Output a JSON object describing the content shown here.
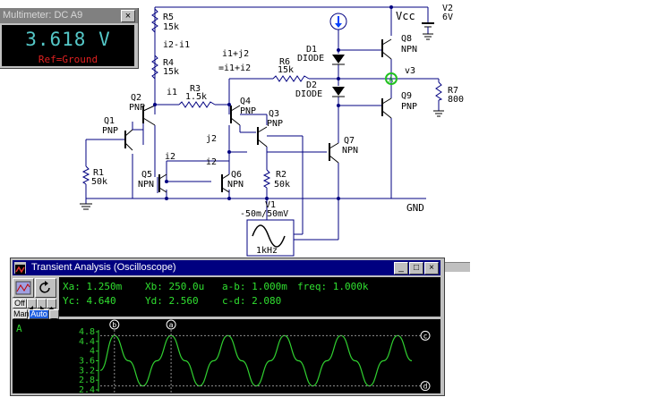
{
  "schematic": {
    "labels": {
      "r5": "R5",
      "r5_val": "15k",
      "i2_i1": "i2-i1",
      "r4": "R4",
      "r4_val": "15k",
      "i1": "i1",
      "r3": "R3",
      "r3_val": "1.5k",
      "i1_j2": "i1+j2",
      "eq": "=i1+i2",
      "r6": "R6",
      "r6_val": "15k",
      "d1": "D1",
      "d1_type": "DIODE",
      "d2": "D2",
      "d2_type": "DIODE",
      "vcc": "Vcc",
      "v2": "V2",
      "v2_val": "6V",
      "q8": "Q8",
      "q8_type": "NPN",
      "v3": "v3",
      "q9": "Q9",
      "q9_type": "PNP",
      "r7": "R7",
      "r7_val": "800",
      "q2": "Q2",
      "q2_type": "PNP",
      "q1": "Q1",
      "q1_type": "PNP",
      "q4": "Q4",
      "q4_type": "PNP",
      "q3": "Q3",
      "q3_type": "PNP",
      "j2": "j2",
      "q7": "Q7",
      "q7_type": "NPN",
      "r1": "R1",
      "r1_val": "50k",
      "i2a": "i2",
      "i2b": "i2",
      "q5": "Q5",
      "q5_type": "NPN",
      "q6": "Q6",
      "q6_type": "NPN",
      "r2": "R2",
      "r2_val": "50k",
      "gnd": "GND",
      "v1": "V1",
      "v1_val": "-50m/50mV",
      "v1_freq": "1kHz",
      "probe": "A"
    },
    "colors": {
      "wire": "#000080",
      "probe": "#20c020",
      "source": "#0040ff"
    }
  },
  "multimeter": {
    "title": "Multimeter: DC A9",
    "reading": "3.618 V",
    "reference": "Ref=Ground",
    "close": "×"
  },
  "oscilloscope": {
    "title": "Transient Analysis (Oscilloscope)",
    "window_buttons": {
      "minimize": "_",
      "maximize": "□",
      "close": "×"
    },
    "buttons": {
      "off": "Off",
      "man": "Man",
      "auto": "Auto"
    },
    "readouts": {
      "xa": "Xa: 1.250m",
      "xb": "Xb: 250.0u",
      "ab": "a-b: 1.000m",
      "freq": "freq: 1.000k",
      "yc": "Yc: 4.640",
      "yd": "Yd: 2.560",
      "cd": "c-d: 2.080"
    },
    "channel": "A",
    "cursors": {
      "a": "a",
      "b": "b",
      "c": "c",
      "d": "d"
    },
    "y_ticks": [
      "4.8",
      "4.4",
      "4",
      "3.6",
      "3.2",
      "2.8",
      "2.4"
    ],
    "trace_color": "#30d030"
  },
  "chart_data": {
    "type": "line",
    "title": "",
    "xlabel": "",
    "ylabel": "",
    "ylim": [
      2.4,
      4.8
    ],
    "series": [
      {
        "name": "A",
        "x": [
          0,
          0.25,
          0.5,
          0.75,
          1.0,
          1.25,
          1.5,
          1.75,
          2.0,
          2.25,
          2.5,
          2.75,
          3.0,
          3.25,
          3.5,
          3.75,
          4.0,
          4.25,
          4.5,
          4.75,
          5.0,
          5.25,
          5.5
        ],
        "y": [
          3.2,
          4.64,
          3.6,
          2.56,
          3.6,
          4.64,
          3.6,
          2.56,
          3.6,
          4.64,
          3.6,
          2.56,
          3.6,
          4.64,
          3.6,
          2.56,
          3.6,
          4.64,
          3.6,
          2.56,
          3.6,
          4.64,
          3.6
        ]
      }
    ],
    "cursors": {
      "b_time_ms": 0.25,
      "a_time_ms": 1.25,
      "c_value": 4.64,
      "d_value": 2.56
    }
  }
}
